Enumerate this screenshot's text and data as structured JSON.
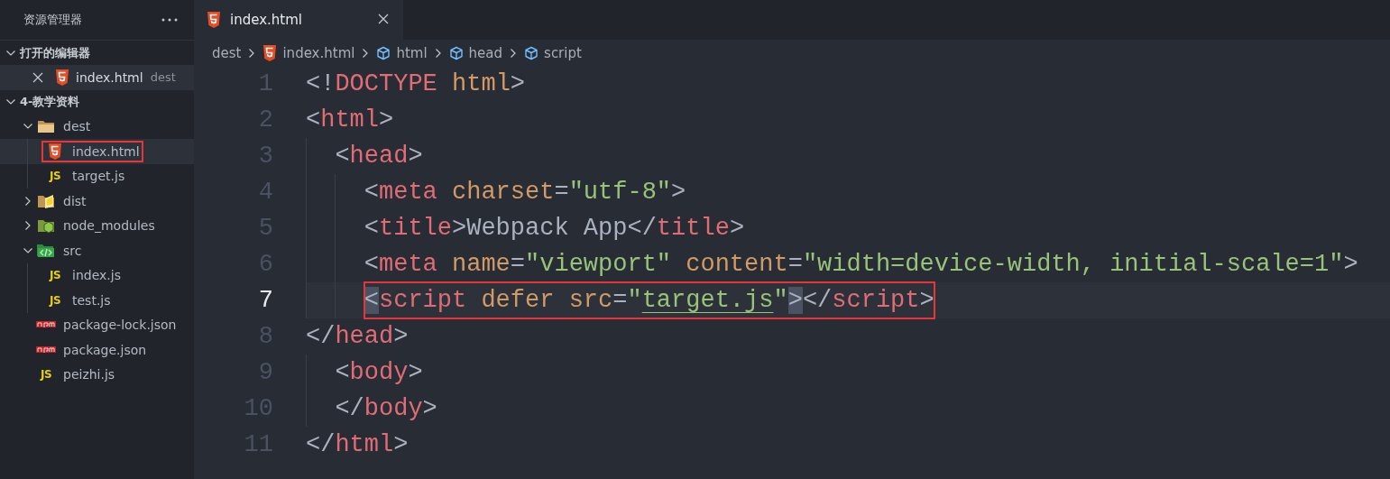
{
  "sidebar": {
    "title": "资源管理器",
    "sections": [
      {
        "title": "打开的编辑器",
        "expanded": true,
        "kind": "editors",
        "items": [
          {
            "name": "index.html",
            "description": "dest",
            "kind": "html",
            "selected": true
          }
        ]
      },
      {
        "title": "4-教学资料",
        "expanded": true,
        "kind": "tree",
        "items": [
          {
            "name": "dest",
            "kind": "folder",
            "expanded": true,
            "selected": false,
            "boxed": false,
            "children": [
              {
                "name": "index.html",
                "kind": "html",
                "selected": true,
                "boxed": true
              },
              {
                "name": "target.js",
                "kind": "js",
                "icon_text": "JS",
                "selected": false,
                "boxed": false
              }
            ]
          },
          {
            "name": "dist",
            "kind": "folder-dist",
            "expanded": false,
            "selected": false,
            "boxed": false
          },
          {
            "name": "node_modules",
            "kind": "folder-node",
            "expanded": false,
            "selected": false,
            "boxed": false
          },
          {
            "name": "src",
            "kind": "folder-src",
            "expanded": true,
            "selected": false,
            "boxed": false,
            "children": [
              {
                "name": "index.js",
                "kind": "js",
                "icon_text": "JS",
                "selected": false,
                "boxed": false
              },
              {
                "name": "test.js",
                "kind": "js",
                "icon_text": "JS",
                "selected": false,
                "boxed": false
              }
            ]
          },
          {
            "name": "package-lock.json",
            "kind": "npm",
            "selected": false,
            "boxed": false
          },
          {
            "name": "package.json",
            "kind": "npm",
            "selected": false,
            "boxed": false
          },
          {
            "name": "peizhi.js",
            "kind": "js",
            "icon_text": "JS",
            "selected": false,
            "boxed": false
          }
        ]
      }
    ]
  },
  "tabs": [
    {
      "label": "index.html",
      "kind": "html",
      "selected": true
    }
  ],
  "breadcrumbs": [
    {
      "text": "dest",
      "kind": "text"
    },
    {
      "text": "index.html",
      "kind": "html"
    },
    {
      "text": "html",
      "kind": "symbol"
    },
    {
      "text": "head",
      "kind": "symbol"
    },
    {
      "text": "script",
      "kind": "symbol"
    }
  ],
  "code": [
    {
      "number": "1",
      "current": false,
      "boxed": false,
      "tokens": [
        {
          "kind": "punct",
          "text": "<!"
        },
        {
          "kind": "tag",
          "text": "DOCTYPE"
        },
        {
          "kind": "attr",
          "text": " html"
        },
        {
          "kind": "punct",
          "text": ">"
        }
      ]
    },
    {
      "number": "2",
      "current": false,
      "boxed": false,
      "tokens": [
        {
          "kind": "punct",
          "text": "<"
        },
        {
          "kind": "tag",
          "text": "html"
        },
        {
          "kind": "punct",
          "text": ">"
        }
      ],
      "children": [
        {
          "number": "3",
          "current": false,
          "boxed": false,
          "tokens": [
            {
              "kind": "punct",
              "text": "<"
            },
            {
              "kind": "tag",
              "text": "head"
            },
            {
              "kind": "punct",
              "text": ">"
            }
          ],
          "children": [
            {
              "number": "4",
              "current": false,
              "boxed": false,
              "tokens": [
                {
                  "kind": "punct",
                  "text": "<"
                },
                {
                  "kind": "tag",
                  "text": "meta"
                },
                {
                  "kind": "attr",
                  "text": " charset"
                },
                {
                  "kind": "punct",
                  "text": "="
                },
                {
                  "kind": "string",
                  "text": "\"utf-8\""
                },
                {
                  "kind": "punct",
                  "text": ">"
                }
              ]
            },
            {
              "number": "5",
              "current": false,
              "boxed": false,
              "tokens": [
                {
                  "kind": "punct",
                  "text": "<"
                },
                {
                  "kind": "tag",
                  "text": "title"
                },
                {
                  "kind": "punct",
                  "text": ">"
                },
                {
                  "kind": "text",
                  "text": "Webpack App"
                },
                {
                  "kind": "punct",
                  "text": "</"
                },
                {
                  "kind": "tag",
                  "text": "title"
                },
                {
                  "kind": "punct",
                  "text": ">"
                }
              ]
            },
            {
              "number": "6",
              "current": false,
              "boxed": false,
              "tokens": [
                {
                  "kind": "punct",
                  "text": "<"
                },
                {
                  "kind": "tag",
                  "text": "meta"
                },
                {
                  "kind": "attr",
                  "text": " name"
                },
                {
                  "kind": "punct",
                  "text": "="
                },
                {
                  "kind": "string",
                  "text": "\"viewport\""
                },
                {
                  "kind": "attr",
                  "text": " content"
                },
                {
                  "kind": "punct",
                  "text": "="
                },
                {
                  "kind": "string",
                  "text": "\"width=device-width, initial-scale=1\""
                },
                {
                  "kind": "punct",
                  "text": ">"
                }
              ]
            },
            {
              "number": "7",
              "current": true,
              "boxed": true,
              "tokens": [
                {
                  "kind": "match",
                  "text": "<"
                },
                {
                  "kind": "tag",
                  "text": "script"
                },
                {
                  "kind": "attr",
                  "text": " defer"
                },
                {
                  "kind": "attr",
                  "text": " src"
                },
                {
                  "kind": "punct",
                  "text": "="
                },
                {
                  "kind": "string",
                  "text": "\""
                },
                {
                  "kind": "link",
                  "text": "target.js"
                },
                {
                  "kind": "string",
                  "text": "\""
                },
                {
                  "kind": "match",
                  "text": ">"
                },
                {
                  "kind": "punct",
                  "text": "</"
                },
                {
                  "kind": "tag",
                  "text": "script"
                },
                {
                  "kind": "punct",
                  "text": ">"
                }
              ]
            }
          ]
        }
      ]
    },
    {
      "number": "8",
      "current": false,
      "boxed": false,
      "tokens": [
        {
          "kind": "punct",
          "text": "</"
        },
        {
          "kind": "tag",
          "text": "head"
        },
        {
          "kind": "punct",
          "text": ">"
        }
      ],
      "children": [
        {
          "number": "9",
          "current": false,
          "boxed": false,
          "tokens": [
            {
              "kind": "punct",
              "text": "<"
            },
            {
              "kind": "tag",
              "text": "body"
            },
            {
              "kind": "punct",
              "text": ">"
            }
          ]
        },
        {
          "number": "10",
          "current": false,
          "boxed": false,
          "tokens": [
            {
              "kind": "punct",
              "text": "</"
            },
            {
              "kind": "tag",
              "text": "body"
            },
            {
              "kind": "punct",
              "text": ">"
            }
          ]
        }
      ]
    },
    {
      "number": "11",
      "current": false,
      "boxed": false,
      "tokens": [
        {
          "kind": "punct",
          "text": "</"
        },
        {
          "kind": "tag",
          "text": "html"
        },
        {
          "kind": "punct",
          "text": ">"
        }
      ]
    }
  ]
}
